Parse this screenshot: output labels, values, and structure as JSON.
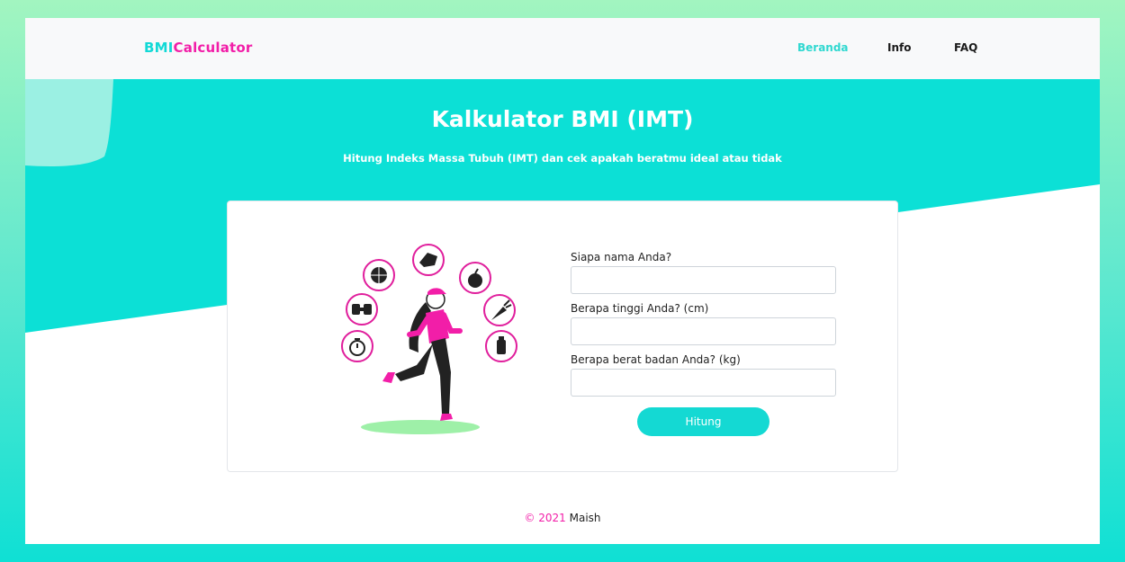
{
  "brand": {
    "part1": "BMI",
    "part2": "Calculator"
  },
  "nav": {
    "items": [
      {
        "label": "Beranda",
        "active": true
      },
      {
        "label": "Info",
        "active": false
      },
      {
        "label": "FAQ",
        "active": false
      }
    ]
  },
  "hero": {
    "title": "Kalkulator BMI (IMT)",
    "subtitle": "Hitung Indeks Massa Tubuh (IMT) dan cek apakah beratmu ideal atau tidak"
  },
  "form": {
    "name_label": "Siapa nama Anda?",
    "name_value": "",
    "height_label": "Berapa tinggi Anda? (cm)",
    "height_value": "",
    "weight_label": "Berapa berat badan Anda? (kg)",
    "weight_value": "",
    "submit_label": "Hitung"
  },
  "illustration": {
    "icons": [
      "basketball-icon",
      "clapping-hands-icon",
      "apple-icon",
      "dumbbell-icon",
      "carrot-icon",
      "stopwatch-icon",
      "water-bottle-icon"
    ]
  },
  "footer": {
    "copyright": "© 2021",
    "author": "Maish"
  },
  "colors": {
    "accent_teal": "#14d9d3",
    "accent_pink": "#f21ea8",
    "navbar_bg": "#f8f9fa",
    "shadow_green": "#9ef0a8"
  }
}
